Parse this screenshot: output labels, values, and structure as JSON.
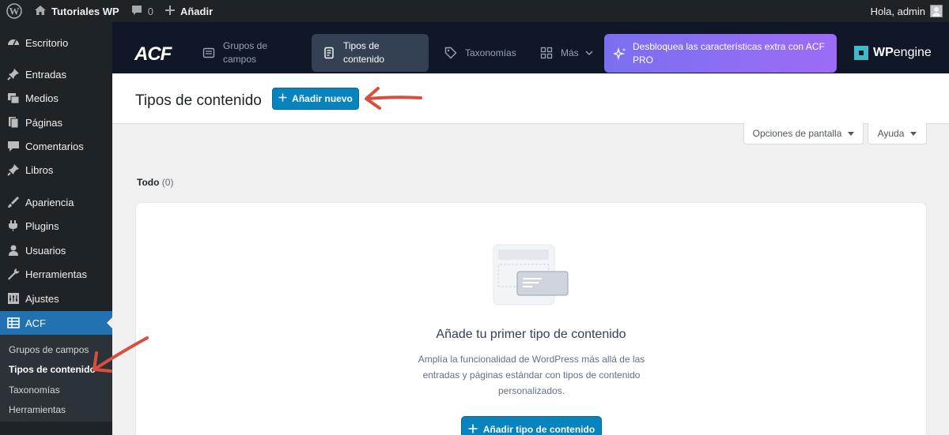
{
  "admin_bar": {
    "site_name": "Tutoriales WP",
    "comments_count": "0",
    "new_label": "Añadir",
    "greeting": "Hola, admin"
  },
  "sidebar": {
    "items": [
      {
        "label": "Escritorio",
        "icon": "dashboard-icon"
      },
      {
        "label": "Entradas",
        "icon": "pin-icon"
      },
      {
        "label": "Medios",
        "icon": "media-icon"
      },
      {
        "label": "Páginas",
        "icon": "pages-icon"
      },
      {
        "label": "Comentarios",
        "icon": "comments-icon"
      },
      {
        "label": "Libros",
        "icon": "pin-icon"
      },
      {
        "label": "Apariencia",
        "icon": "appearance-icon"
      },
      {
        "label": "Plugins",
        "icon": "plugins-icon"
      },
      {
        "label": "Usuarios",
        "icon": "users-icon"
      },
      {
        "label": "Herramientas",
        "icon": "tools-icon"
      },
      {
        "label": "Ajustes",
        "icon": "settings-icon"
      },
      {
        "label": "ACF",
        "icon": "acf-table-icon"
      }
    ],
    "submenu": [
      {
        "label": "Grupos de campos"
      },
      {
        "label": "Tipos de contenido"
      },
      {
        "label": "Taxonomías"
      },
      {
        "label": "Herramientas"
      }
    ]
  },
  "acf_header": {
    "logo": "ACF",
    "tabs": [
      {
        "label": "Grupos de campos",
        "icon": "field-groups-icon"
      },
      {
        "label": "Tipos de contenido",
        "icon": "post-types-icon"
      },
      {
        "label": "Taxonomías",
        "icon": "tag-icon"
      },
      {
        "label": "Más",
        "icon": "grid-icon"
      }
    ],
    "upgrade_label": "Desbloquea las características extra con ACF PRO",
    "partner": {
      "bold": "WP",
      "rest": "engine"
    }
  },
  "title_bar": {
    "title": "Tipos de contenido",
    "add_new_label": "Añadir nuevo"
  },
  "screen_options": {
    "options_label": "Opciones de pantalla",
    "help_label": "Ayuda"
  },
  "filters": {
    "all_label": "Todo",
    "all_count": "(0)"
  },
  "empty_state": {
    "title": "Añade tu primer tipo de contenido",
    "description": "Amplía la funcionalidad de WordPress más allá de las entradas y páginas estándar con tipos de contenido personalizados.",
    "button_label": "Añadir tipo de contenido"
  },
  "colors": {
    "admin_bg": "#1d2327",
    "accent_blue": "#2271b1",
    "acf_header_bg": "#101828",
    "annotation_arrow": "#d94f3d"
  }
}
